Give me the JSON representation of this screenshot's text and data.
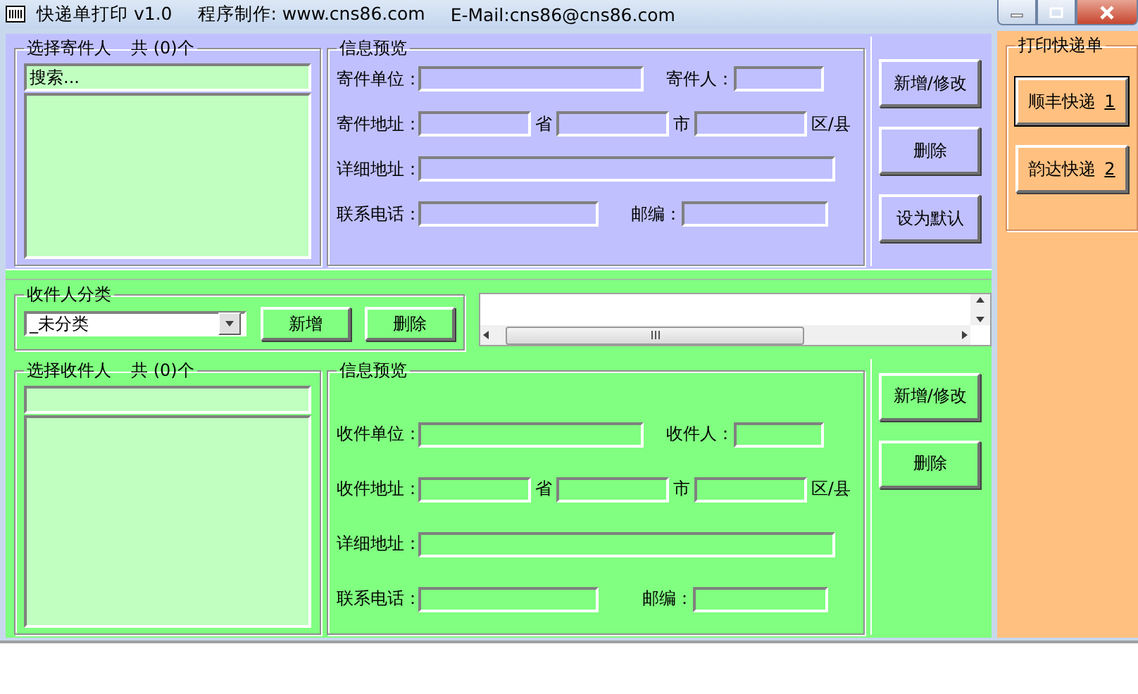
{
  "window": {
    "title": "快递单打印 v1.0",
    "author": "程序制作: www.cns86.com",
    "email": "E-Mail:cns86@cns86.com"
  },
  "sender": {
    "list_title": "选择寄件人",
    "count": "共 (0)个",
    "search": "搜索...",
    "preview_title": "信息预览",
    "rows": [
      {
        "kind": "name",
        "label": "寄件单位：",
        "second_label": "寄件人："
      },
      {
        "kind": "address",
        "label": "寄件地址：",
        "units": [
          "省",
          "市",
          "区/县"
        ]
      },
      {
        "kind": "detail",
        "label": "详细地址："
      },
      {
        "kind": "contact",
        "label": "联系电话：",
        "second_label": "邮编："
      }
    ],
    "buttons": [
      "新增/修改",
      "删除",
      "设为默认"
    ]
  },
  "category": {
    "title": "收件人分类",
    "value": "_未分类",
    "buttons": [
      "新增",
      "删除"
    ]
  },
  "recipient": {
    "list_title": "选择收件人",
    "count": "共 (0)个",
    "preview_title": "信息预览",
    "rows": [
      {
        "kind": "name",
        "label": "收件单位：",
        "second_label": "收件人："
      },
      {
        "kind": "address",
        "label": "收件地址：",
        "units": [
          "省",
          "市",
          "区/县"
        ]
      },
      {
        "kind": "detail",
        "label": "详细地址："
      },
      {
        "kind": "contact",
        "label": "联系电话：",
        "second_label": "邮编："
      }
    ],
    "buttons": [
      "新增/修改",
      "删除"
    ]
  },
  "print": {
    "title": "打印快递单",
    "buttons": [
      {
        "label": "顺丰快递",
        "hotkey": "1",
        "selected": true
      },
      {
        "label": "韵达快递",
        "hotkey": "2",
        "selected": false
      }
    ]
  }
}
